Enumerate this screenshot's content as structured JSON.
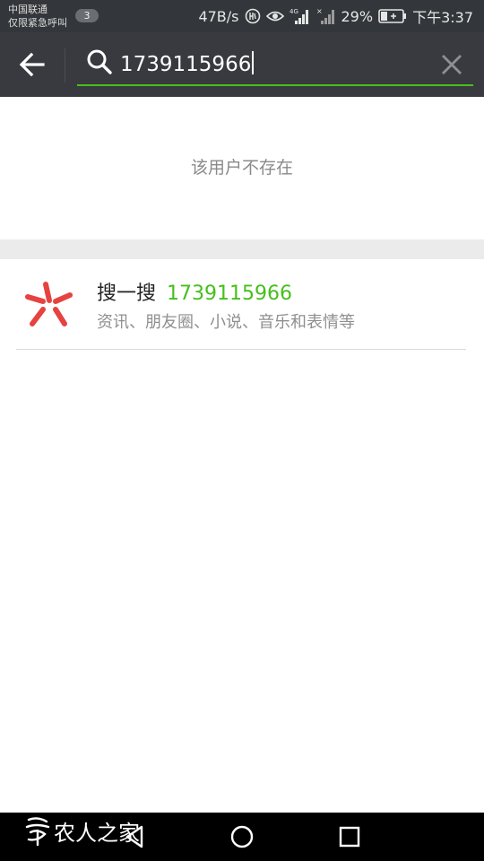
{
  "status_bar": {
    "carrier_line1": "中国联通",
    "carrier_line2": "仅限紧急呼叫",
    "notification_count": "3",
    "net_speed": "47B/s",
    "battery": "29%",
    "time": "下午3:37"
  },
  "search": {
    "query": "1739115966"
  },
  "empty_message": "该用户不存在",
  "sousou": {
    "title": "搜一搜",
    "keyword": "1739115966",
    "subtitle": "资讯、朋友圈、小说、音乐和表情等"
  },
  "watermark": "农人之家",
  "colors": {
    "accent": "#45c01a",
    "header": "#393a3f",
    "status_bar": "#33363a",
    "logo_red": "#e64340"
  }
}
